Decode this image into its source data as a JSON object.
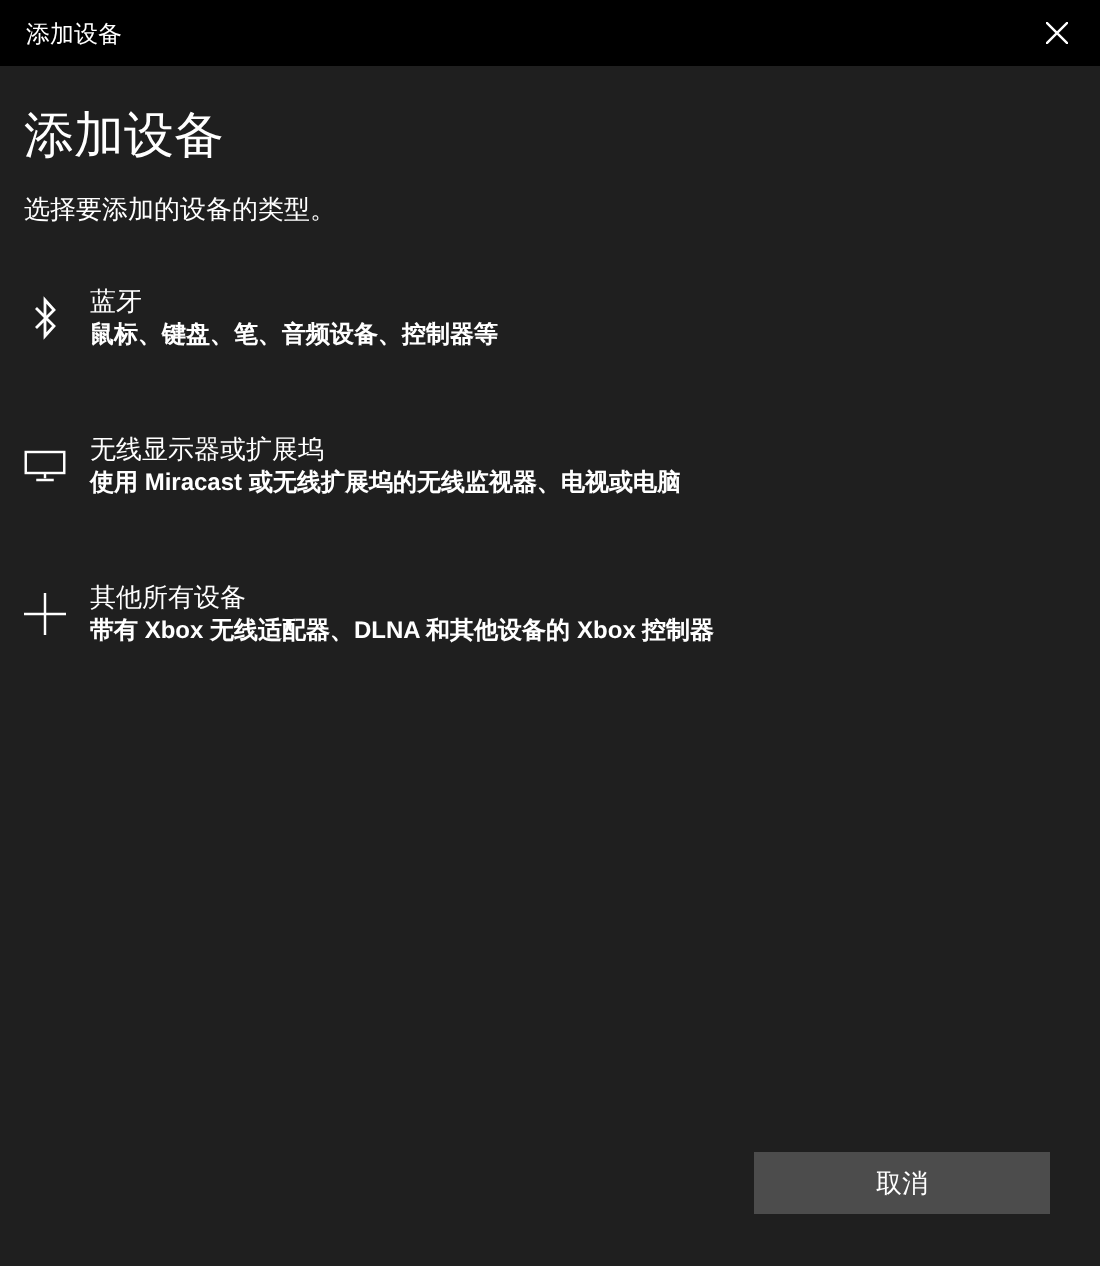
{
  "window": {
    "title": "添加设备"
  },
  "heading": "添加设备",
  "subtitle": "选择要添加的设备的类型。",
  "device_types": [
    {
      "kind": "bluetooth",
      "title": "蓝牙",
      "description": "鼠标、键盘、笔、音频设备、控制器等"
    },
    {
      "kind": "display",
      "title": "无线显示器或扩展坞",
      "description": "使用 Miracast 或无线扩展坞的无线监视器、电视或电脑"
    },
    {
      "kind": "other",
      "title": "其他所有设备",
      "description": "带有 Xbox 无线适配器、DLNA 和其他设备的 Xbox 控制器"
    }
  ],
  "buttons": [
    "取消"
  ]
}
